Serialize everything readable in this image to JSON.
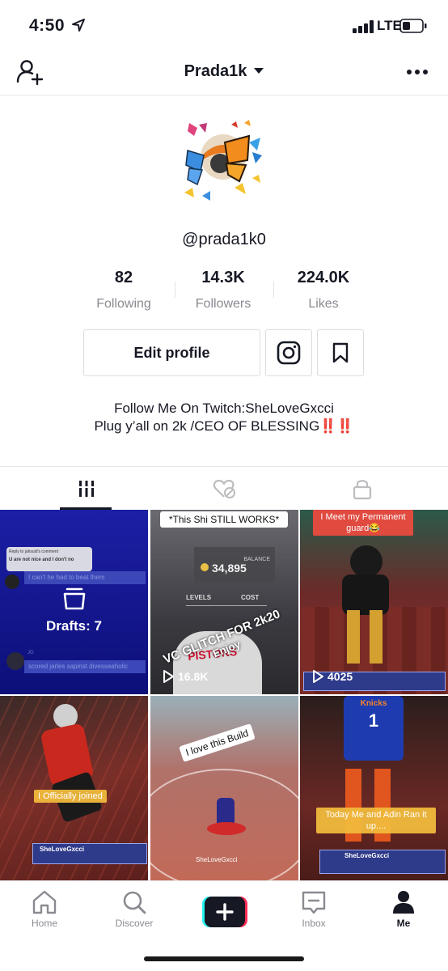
{
  "status_bar": {
    "time": "4:50",
    "network": "LTE"
  },
  "header": {
    "title": "Prada1k"
  },
  "profile": {
    "handle": "@prada1k0",
    "stats": [
      {
        "value": "82",
        "label": "Following"
      },
      {
        "value": "14.3K",
        "label": "Followers"
      },
      {
        "value": "224.0K",
        "label": "Likes"
      }
    ],
    "edit_button": "Edit profile",
    "bio_line1": "Follow Me On Twitch:SheLoveGxcci",
    "bio_line2": "Plug y’all on 2k /CEO OF BLESSING",
    "bio_emoji": "‼️‼️"
  },
  "tabs": [
    {
      "icon": "grid-icon",
      "active": true
    },
    {
      "icon": "liked-icon",
      "active": false
    },
    {
      "icon": "lock-icon",
      "active": false
    }
  ],
  "videos": [
    {
      "type": "drafts",
      "label": "Drafts: 7",
      "overlay_lines": [
        "Reply to jahsuid's comment",
        "U are not nice and I don't no",
        "I can't he had to beat them",
        "JG",
        "scored jarles sapinst divesseaholic"
      ]
    },
    {
      "caption_top": "*This Shi STILL WORKS*",
      "overlay": "VC GLITCH FOR 2k20",
      "overlay2": "Enjoy",
      "balance_label": "BALANCE",
      "balance": "34,895",
      "levels": "LEVELS",
      "cost": "COST",
      "jersey": "PISTONS",
      "views": "16.8K"
    },
    {
      "caption_top": "I Meet my Permanent guard😂",
      "views": "4025"
    },
    {
      "caption": "I Officially joined",
      "name_tag": "SheLoveGxcci"
    },
    {
      "caption_top": "I love this Build",
      "watermark": "SheLoveGxcci"
    },
    {
      "caption": "Today Me and Adin Ran it up....",
      "jersey_text": "Knicks",
      "jersey_number": "1",
      "name_tag": "SheLoveGxcci"
    }
  ],
  "bottom_nav": [
    {
      "label": "Home",
      "icon": "home-icon"
    },
    {
      "label": "Discover",
      "icon": "discover-icon"
    },
    {
      "label": "",
      "icon": "create-icon"
    },
    {
      "label": "Inbox",
      "icon": "inbox-icon"
    },
    {
      "label": "Me",
      "icon": "me-icon",
      "active": true
    }
  ],
  "colors": {
    "accent_red": "#e8243a",
    "tiktok_cyan": "#25f4ee",
    "tiktok_red": "#fe2c55"
  }
}
